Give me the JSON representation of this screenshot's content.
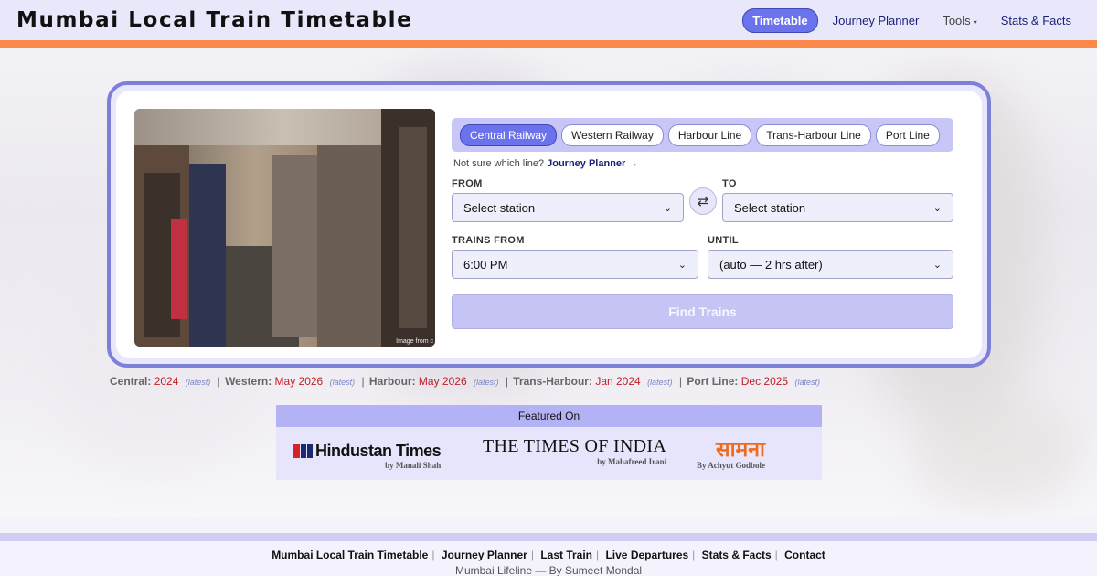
{
  "header": {
    "title": "Mumbai Local Train Timetable",
    "nav": [
      {
        "label": "Timetable",
        "active": true
      },
      {
        "label": "Journey Planner"
      },
      {
        "label": "Tools"
      },
      {
        "label": "Stats & Facts"
      }
    ]
  },
  "card": {
    "photo_credit": "Image from c",
    "line_tabs": [
      "Central Railway",
      "Western Railway",
      "Harbour Line",
      "Trans-Harbour Line",
      "Port Line"
    ],
    "active_line": "Central Railway",
    "hint_text": "Not sure which line?",
    "hint_link": "Journey Planner →",
    "from_label": "FROM",
    "to_label": "TO",
    "from_value": "Select station",
    "to_value": "Select station",
    "trains_from_label": "TRAINS FROM",
    "until_label": "UNTIL",
    "trains_from_value": "6:00 PM",
    "until_value": "(auto — 2 hrs after)",
    "find_button": "Find Trains",
    "swap_icon": "⇄"
  },
  "timetable_dates": [
    {
      "line": "Central:",
      "date": "2024"
    },
    {
      "line": "Western:",
      "date": "May 2026"
    },
    {
      "line": "Harbour:",
      "date": "May 2026"
    },
    {
      "line": "Trans-Harbour:",
      "date": "Jan 2024"
    },
    {
      "line": "Port Line:",
      "date": "Dec 2025"
    }
  ],
  "latest_label": "(latest)",
  "featured": {
    "heading": "Featured On",
    "outlets": [
      {
        "name": "Hindustan Times",
        "by": "by Manali Shah"
      },
      {
        "name": "THE TIMES OF INDIA",
        "by": "by Mahafreed Irani"
      },
      {
        "name": "सामना",
        "by": "By Achyut Godbole"
      }
    ]
  },
  "footer": {
    "links": [
      "Mumbai Local Train Timetable",
      "Journey Planner",
      "Last Train",
      "Live Departures",
      "Stats & Facts",
      "Contact"
    ],
    "tagline": "Mumbai Lifeline — By Sumeet Mondal"
  },
  "colors": {
    "accent": "#6a73ec",
    "orange_bar": "#fb8a4a",
    "date_red": "#c0202a",
    "card_border": "#7d7fd9"
  }
}
